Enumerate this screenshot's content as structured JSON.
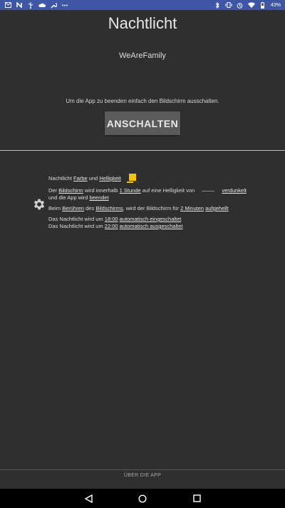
{
  "status_bar": {
    "left_icons": [
      "mail-icon",
      "n-app-icon",
      "usb-icon",
      "cloud-icon",
      "wrench-icon",
      "dots-icon"
    ],
    "right_icons": [
      "bluetooth-icon",
      "vibrate-icon",
      "alarm-icon",
      "wifi-icon",
      "battery-icon"
    ],
    "battery_percent": "43%",
    "color": "#3f55a6"
  },
  "app": {
    "title": "Nachtlicht",
    "subtitle": "WeAreFamily",
    "info_text": "Um die App zu beenden einfach den Bildschirm ausschalten.",
    "button_label": "ANSCHALTEN"
  },
  "settings": {
    "color_line": {
      "prefix": "Nachtlicht",
      "link1": "Farbe",
      "mid": "und",
      "link2": "Helligkeit",
      "swatch_color": "#f5c400",
      "brightness": 0.6
    },
    "screen_line": {
      "p1": "Der",
      "link1": "Bildschirm",
      "p2": "wird innerhalb",
      "link2": "1 Stunde",
      "p3": "auf eine Helligkeit von",
      "link3": "verdunkelt",
      "p4": "und die App wird",
      "link4": "beendet"
    },
    "touch_line": {
      "p1": "Beim",
      "link1": "Berühren",
      "p2": "des",
      "link2": "Bildschirms",
      "p3": ", wird der Bildschirm für",
      "link3": "2 Minuten",
      "link4": "aufgehellt"
    },
    "auto_on": {
      "p1": "Das Nachtlicht wird um",
      "time": "18:00",
      "link": "automatisch eingeschaltet"
    },
    "auto_off": {
      "p1": "Das Nachtlicht wird um",
      "time": "22:00",
      "link": "automatisch ausgeschaltet"
    }
  },
  "footer": {
    "about_label": "ÜBER DIE APP"
  },
  "nav_bar": {
    "buttons": [
      "back-icon",
      "home-icon",
      "recents-icon"
    ]
  }
}
